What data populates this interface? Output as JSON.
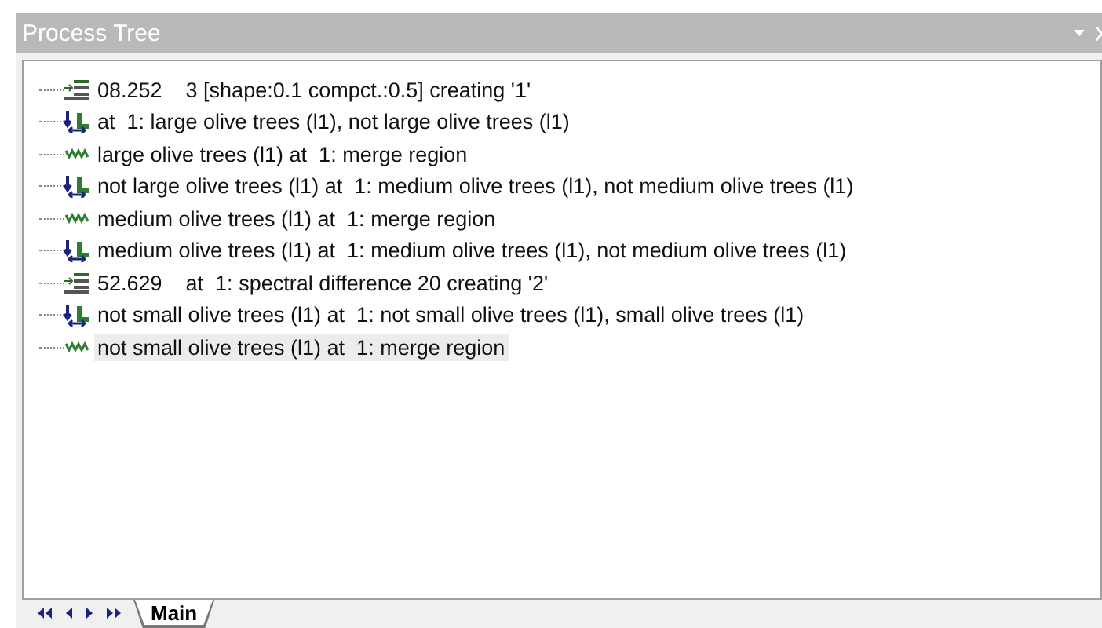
{
  "panel": {
    "title": "Process Tree"
  },
  "tree": {
    "items": [
      {
        "kind": "process",
        "text": "08.252    3 [shape:0.1 compct.:0.5] creating '1'",
        "selected": false
      },
      {
        "kind": "classify",
        "text": "at  1: large olive trees (l1), not large olive trees (l1)",
        "selected": false
      },
      {
        "kind": "merge",
        "text": "large olive trees (l1) at  1: merge region",
        "selected": false
      },
      {
        "kind": "classify",
        "text": "not large olive trees (l1) at  1: medium olive trees (l1), not medium olive trees (l1)",
        "selected": false
      },
      {
        "kind": "merge",
        "text": "medium olive trees (l1) at  1: merge region",
        "selected": false
      },
      {
        "kind": "classify",
        "text": "medium olive trees (l1) at  1: medium olive trees (l1), not medium olive trees (l1)",
        "selected": false
      },
      {
        "kind": "process",
        "text": "52.629    at  1: spectral difference 20 creating '2'",
        "selected": false
      },
      {
        "kind": "classify",
        "text": "not small olive trees (l1) at  1: not small olive trees (l1), small olive trees (l1)",
        "selected": false
      },
      {
        "kind": "merge",
        "text": "not small olive trees (l1) at  1: merge region",
        "selected": true
      }
    ]
  },
  "tabs": [
    {
      "label": "Main",
      "selected": true
    }
  ]
}
